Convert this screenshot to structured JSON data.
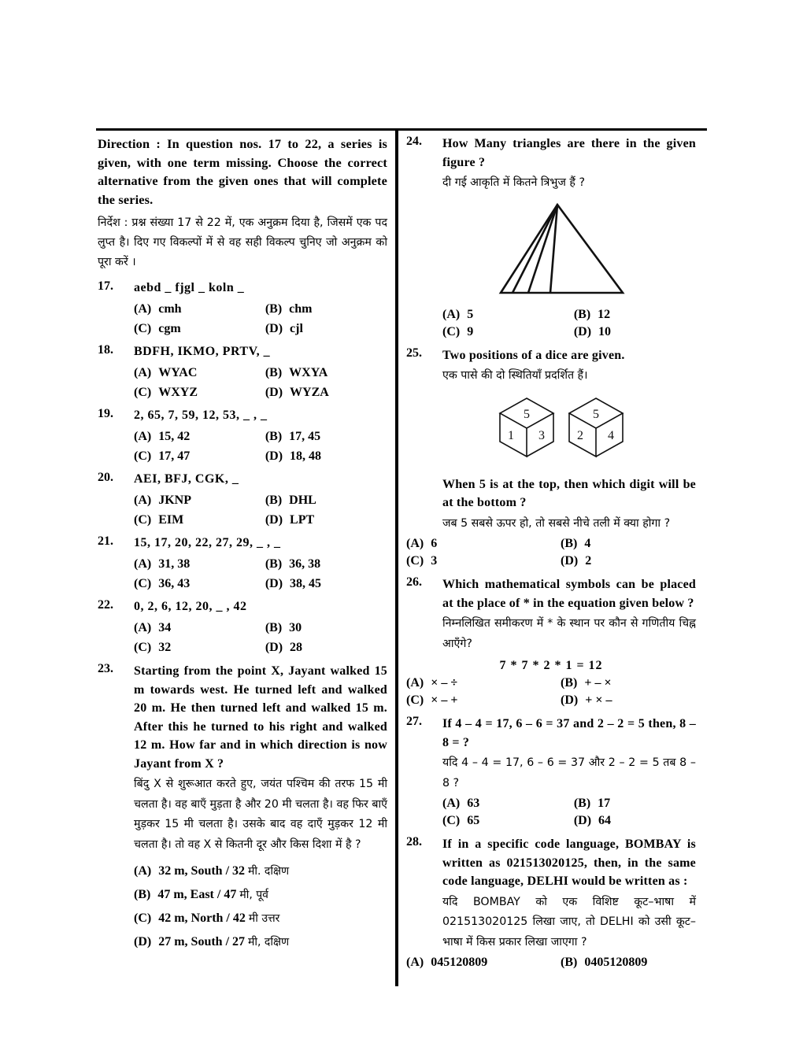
{
  "direction": {
    "en": "Direction : In question nos. 17 to 22, a series is given, with one term missing. Choose the correct alternative from the given ones that will complete the series.",
    "hi": "निर्देश : प्रश्न संख्या 17 से 22 में, एक अनुक्रम दिया है, जिसमें एक पद लुप्त है। दिए गए विकल्पों में से वह सही विकल्प चुनिए जो अनुक्रम को पूरा करें ।"
  },
  "questions": {
    "q17": {
      "num": "17.",
      "stem": "aebd _ fjgl _ koln _",
      "a": "(A)",
      "a_text": "cmh",
      "b": "(B)",
      "b_text": "chm",
      "c": "(C)",
      "c_text": "cgm",
      "d": "(D)",
      "d_text": "cjl"
    },
    "q18": {
      "num": "18.",
      "stem": "BDFH, IKMO, PRTV, _",
      "a": "(A)",
      "a_text": "WYAC",
      "b": "(B)",
      "b_text": "WXYA",
      "c": "(C)",
      "c_text": "WXYZ",
      "d": "(D)",
      "d_text": "WYZA"
    },
    "q19": {
      "num": "19.",
      "stem": "2, 65, 7, 59, 12, 53, _ , _",
      "a": "(A)",
      "a_text": "15, 42",
      "b": "(B)",
      "b_text": "17, 45",
      "c": "(C)",
      "c_text": "17, 47",
      "d": "(D)",
      "d_text": "18, 48"
    },
    "q20": {
      "num": "20.",
      "stem": "AEI, BFJ, CGK, _",
      "a": "(A)",
      "a_text": "JKNP",
      "b": "(B)",
      "b_text": "DHL",
      "c": "(C)",
      "c_text": "EIM",
      "d": "(D)",
      "d_text": "LPT"
    },
    "q21": {
      "num": "21.",
      "stem": "15, 17, 20, 22, 27, 29,  _ ,  _",
      "a": "(A)",
      "a_text": "31, 38",
      "b": "(B)",
      "b_text": "36, 38",
      "c": "(C)",
      "c_text": "36, 43",
      "d": "(D)",
      "d_text": "38, 45"
    },
    "q22": {
      "num": "22.",
      "stem": "0, 2, 6, 12, 20, _ , 42",
      "a": "(A)",
      "a_text": "34",
      "b": "(B)",
      "b_text": "30",
      "c": "(C)",
      "c_text": "32",
      "d": "(D)",
      "d_text": "28"
    },
    "q23": {
      "num": "23.",
      "en": "Starting from the point X, Jayant walked 15 m towards west. He turned left and walked 20 m. He then turned left and walked 15 m. After this he turned to his right and walked 12 m. How far and in which direction is now Jayant from X ?",
      "hi": "बिंदु X से शुरूआत करते हुए, जयंत पश्चिम की तरफ 15 मी चलता है। वह बाएँ मुड़ता है और 20 मी चलता है। वह फिर बाएँ मुड़कर 15 मी चलता है। उसके बाद वह दाएँ मुड़कर 12 मी चलता है। तो वह X से कितनी दूर और किस दिशा में है ?",
      "a": "(A)",
      "a_text": "32 m, South / 32",
      "a_hi": "मी. दक्षिण",
      "b": "(B)",
      "b_text": "47 m, East / 47",
      "b_hi": "मी, पूर्व",
      "c": "(C)",
      "c_text": "42 m, North / 42",
      "c_hi": "मी उत्तर",
      "d": "(D)",
      "d_text": "27 m, South / 27",
      "d_hi": "मी, दक्षिण"
    },
    "q24": {
      "num": "24.",
      "en": "How Many triangles are there in the given figure ?",
      "hi": "दी गई आकृति में कितने त्रिभुज हैं ?",
      "figure": "triangle-with-cevians",
      "a": "(A)",
      "a_text": "5",
      "b": "(B)",
      "b_text": "12",
      "c": "(C)",
      "c_text": "9",
      "d": "(D)",
      "d_text": "10"
    },
    "q25": {
      "num": "25.",
      "en": "Two positions of a dice are given.",
      "hi": "एक पासे की दो स्थितियाँ प्रदर्शित हैं।",
      "dice": [
        {
          "top": "5",
          "left": "1",
          "right": "3"
        },
        {
          "top": "5",
          "left": "2",
          "right": "4"
        }
      ],
      "en2": "When 5 is at the top, then which digit will be at the bottom ?",
      "hi2": "जब 5 सबसे ऊपर हो, तो सबसे नीचे तली में क्या होगा ?",
      "a": "(A)",
      "a_text": "6",
      "b": "(B)",
      "b_text": "4",
      "c": "(C)",
      "c_text": "3",
      "d": "(D)",
      "d_text": "2"
    },
    "q26": {
      "num": "26.",
      "en": "Which mathematical symbols can be placed at the place of * in the equation given below ?",
      "hi": "निम्नलिखित समीकरण में * के स्थान पर कौन से गणितीय चिह्न आएँगे?",
      "equation": "7 * 7 * 2 * 1 = 12",
      "a": "(A)",
      "a_text": "× – ÷",
      "b": "(B)",
      "b_text": "+ – ×",
      "c": "(C)",
      "c_text": "× – +",
      "d": "(D)",
      "d_text": "+ × –"
    },
    "q27": {
      "num": "27.",
      "en": "If 4 – 4 = 17, 6 – 6 = 37 and 2 – 2 = 5 then, 8 – 8 = ?",
      "hi": "यदि 4 – 4 = 17, 6 – 6 = 37 और 2 – 2 = 5 तब 8 – 8 ?",
      "a": "(A)",
      "a_text": "63",
      "b": "(B)",
      "b_text": "17",
      "c": "(C)",
      "c_text": "65",
      "d": "(D)",
      "d_text": "64"
    },
    "q28": {
      "num": "28.",
      "en": "If in a specific code language, BOMBAY is written as 021513020125, then, in the same code language, DELHI would be written as :",
      "hi": "यदि BOMBAY को एक विशिष्ट कूट–भाषा में 021513020125 लिखा जाए, तो DELHI को उसी कूट–भाषा में किस प्रकार लिखा जाएगा ?",
      "a": "(A)",
      "a_text": "045120809",
      "b": "(B)",
      "b_text": "0405120809"
    }
  }
}
